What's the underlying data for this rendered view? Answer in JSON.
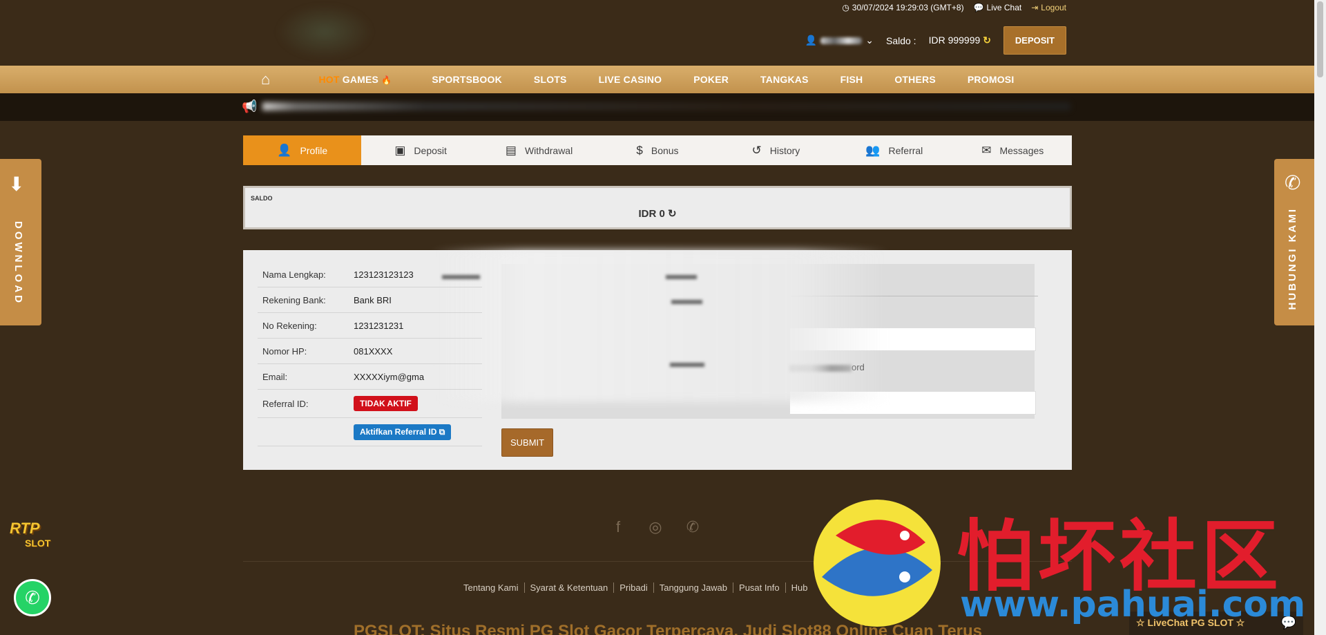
{
  "header": {
    "datetime": "30/07/2024 19:29:03 (GMT+8)",
    "live_chat": "Live Chat",
    "logout": "Logout",
    "saldo_label": "Saldo :",
    "saldo_value": "IDR 999999",
    "deposit_button": "DEPOSIT"
  },
  "nav": {
    "hot_prefix": "HOT",
    "hot_games": "GAMES",
    "items": [
      "SPORTSBOOK",
      "SLOTS",
      "LIVE CASINO",
      "POKER",
      "TANGKAS",
      "FISH",
      "OTHERS",
      "PROMOSI"
    ]
  },
  "tabs": [
    {
      "label": "Profile",
      "icon": "user-icon",
      "active": true
    },
    {
      "label": "Deposit",
      "icon": "wallet-icon"
    },
    {
      "label": "Withdrawal",
      "icon": "money-icon"
    },
    {
      "label": "Bonus",
      "icon": "dollar-icon"
    },
    {
      "label": "History",
      "icon": "history-icon"
    },
    {
      "label": "Referral",
      "icon": "users-icon"
    },
    {
      "label": "Messages",
      "icon": "envelope-icon"
    }
  ],
  "saldo_panel": {
    "label": "SALDO",
    "value": "IDR 0"
  },
  "profile": {
    "rows": [
      {
        "key": "Nama Lengkap:",
        "value": "123123123123"
      },
      {
        "key": "Rekening Bank:",
        "value": "Bank BRI"
      },
      {
        "key": "No Rekening:",
        "value": "1231231231"
      },
      {
        "key": "Nomor HP:",
        "value": "081XXXX"
      },
      {
        "key": "Email:",
        "value": "XXXXXiym@gma"
      }
    ],
    "referral_label": "Referral ID:",
    "referral_status": "TIDAK AKTIF",
    "activate_referral": "Aktifkan Referral ID",
    "password_suffix": "ord",
    "submit": "SUBMIT"
  },
  "side": {
    "download": "DOWNLOAD",
    "contact": "HUBUNGI KAMI"
  },
  "footer": {
    "links": [
      "Tentang Kami",
      "Syarat & Ketentuan",
      "Pribadi",
      "Tanggung Jawab",
      "Pusat Info",
      "Hub"
    ],
    "title": "PGSLOT: Situs Resmi PG Slot Gacor Terpercaya, Judi Slot88 Online Cuan Terus",
    "rtp_top": "RTP",
    "rtp_bottom": "SLOT",
    "livechat": "☆ LiveChat PG SLOT ☆"
  },
  "watermark": {
    "chinese": "怕坏社区",
    "url": "www.pahuai.com"
  },
  "colors": {
    "background": "#3a2b19",
    "accent": "#e9911b",
    "nav": "#c99a55",
    "button": "#a8702a",
    "badge_red": "#d1101a",
    "badge_blue": "#1b79c5"
  }
}
